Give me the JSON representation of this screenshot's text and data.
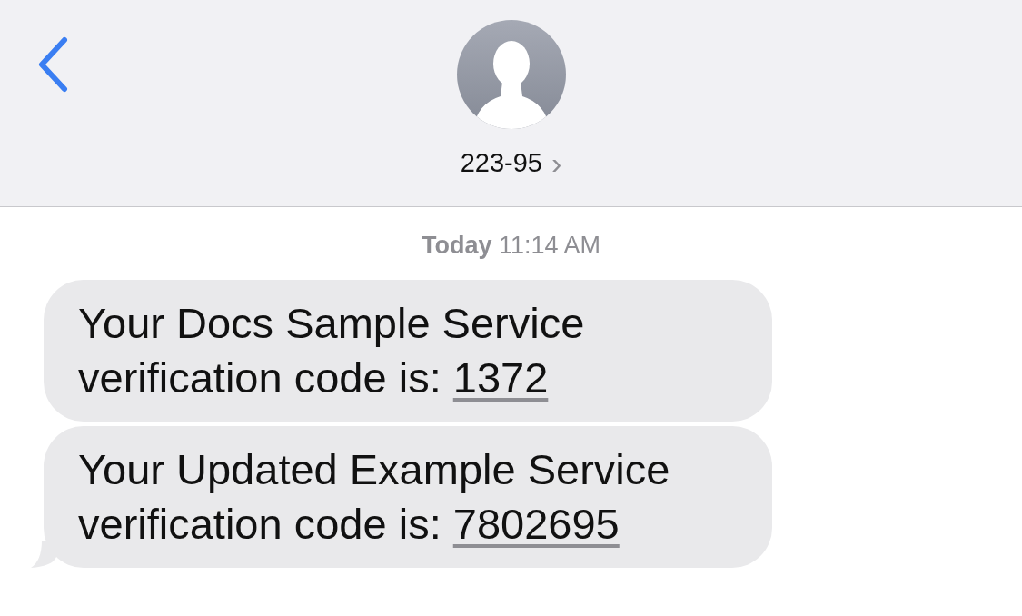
{
  "header": {
    "contact": "223-95",
    "chevron": "›"
  },
  "timestamp": {
    "day": "Today",
    "time": "11:14 AM"
  },
  "messages": [
    {
      "text": "Your Docs Sample Service verification code is:",
      "code": "1372",
      "tail": false
    },
    {
      "text": "Your Updated Example Service verification code is:",
      "code": "7802695",
      "tail": true
    }
  ]
}
